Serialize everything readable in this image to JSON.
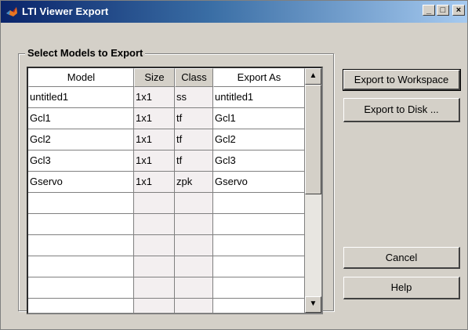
{
  "window": {
    "title": "LTI Viewer Export",
    "minimize_label": "_",
    "maximize_label": "□",
    "close_label": "×"
  },
  "group": {
    "label": "Select Models to Export"
  },
  "table": {
    "columns": [
      "Model",
      "Size",
      "Class",
      "Export As"
    ],
    "rows": [
      [
        "untitled1",
        "1x1",
        "ss",
        "untitled1"
      ],
      [
        "Gcl1",
        "1x1",
        "tf",
        "Gcl1"
      ],
      [
        "Gcl2",
        "1x1",
        "tf",
        "Gcl2"
      ],
      [
        "Gcl3",
        "1x1",
        "tf",
        "Gcl3"
      ],
      [
        "Gservo",
        "1x1",
        "zpk",
        "Gservo"
      ],
      [
        "",
        "",
        "",
        ""
      ],
      [
        "",
        "",
        "",
        ""
      ],
      [
        "",
        "",
        "",
        ""
      ],
      [
        "",
        "",
        "",
        ""
      ],
      [
        "",
        "",
        "",
        ""
      ],
      [
        "",
        "",
        "",
        ""
      ]
    ]
  },
  "buttons": {
    "export_workspace": "Export to Workspace",
    "export_disk": "Export to Disk ...",
    "cancel": "Cancel",
    "help": "Help"
  },
  "icons": {
    "app": "matlab-icon",
    "scroll_up": "arrow-up-icon",
    "scroll_down": "arrow-down-icon"
  }
}
